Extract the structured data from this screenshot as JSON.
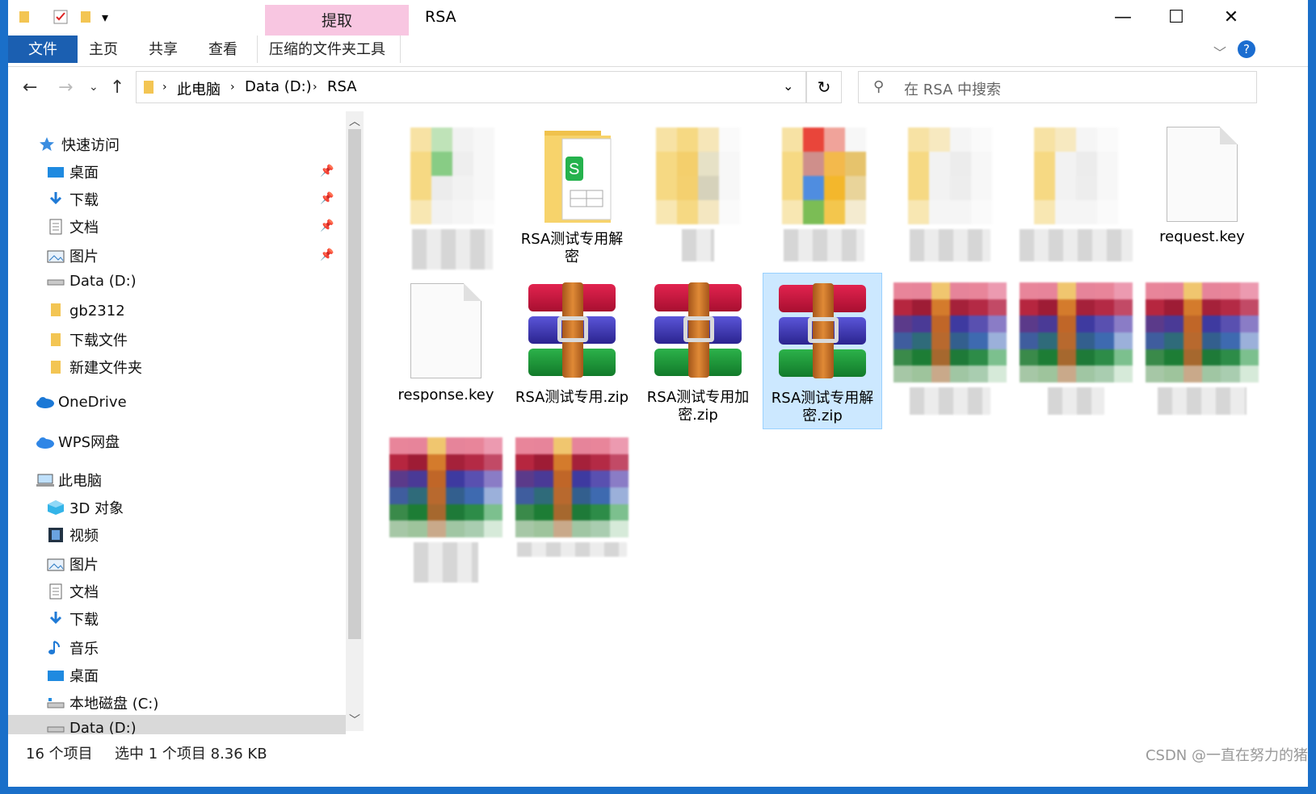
{
  "window": {
    "title": "RSA",
    "context_tab": "提取",
    "minimize": "—",
    "maximize": "☐",
    "close": "✕"
  },
  "ribbon": {
    "tabs": [
      "文件",
      "主页",
      "共享",
      "查看",
      "压缩的文件夹工具"
    ],
    "help": "?"
  },
  "address": {
    "crumbs": [
      "此电脑",
      "Data (D:)",
      "RSA"
    ],
    "search_placeholder": "在 RSA 中搜索"
  },
  "navpane": {
    "quick_access": "快速访问",
    "quick_items": [
      "桌面",
      "下载",
      "文档",
      "图片",
      "Data (D:)",
      "gb2312",
      "下载文件",
      "新建文件夹"
    ],
    "onedrive": "OneDrive",
    "wps": "WPS网盘",
    "this_pc": "此电脑",
    "pc_items": [
      "3D 对象",
      "视频",
      "图片",
      "文档",
      "下载",
      "音乐",
      "桌面",
      "本地磁盘 (C:)",
      "Data (D:)"
    ]
  },
  "files": {
    "rsa_decrypt": "RSA测试专用解密",
    "request_key": "request.key",
    "response_key": "response.key",
    "rsa_zip": "RSA测试专用.zip",
    "rsa_encrypt_zip": "RSA测试专用加密.zip",
    "rsa_decrypt_zip": "RSA测试专用解密.zip"
  },
  "status": {
    "count": "16 个项目",
    "selected": "选中 1 个项目  8.36 KB"
  },
  "watermark": "CSDN @一直在努力的猪"
}
